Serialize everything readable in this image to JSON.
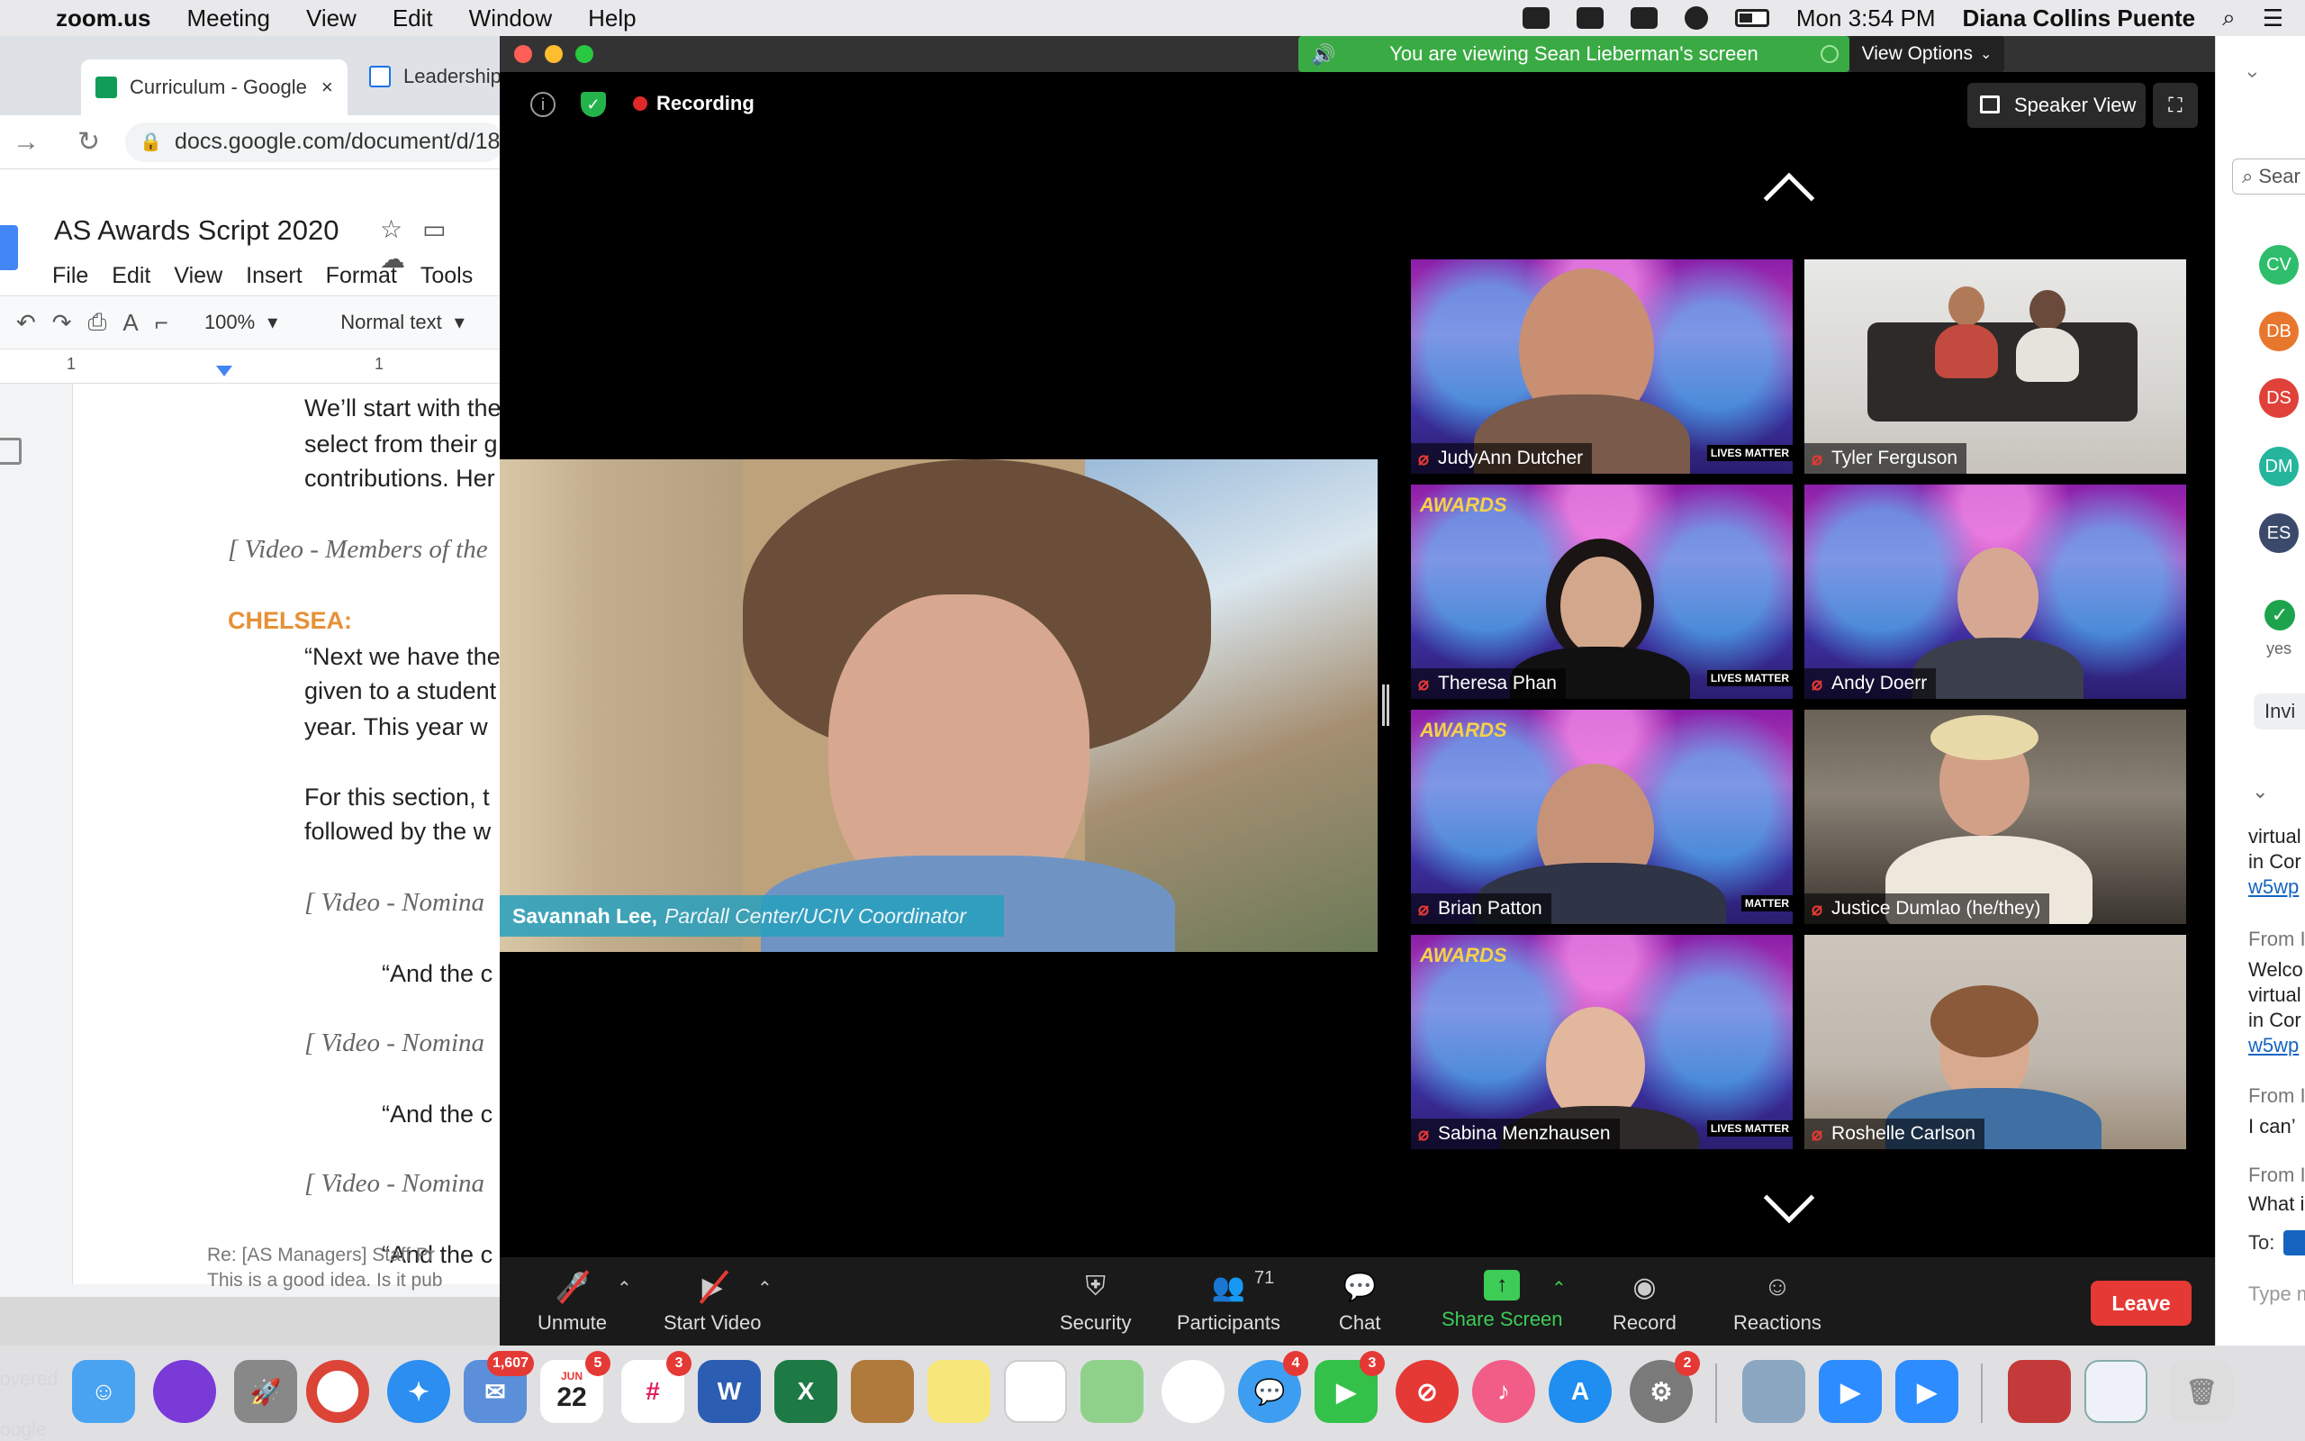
{
  "menubar": {
    "app": "zoom.us",
    "items": [
      "Meeting",
      "View",
      "Edit",
      "Window",
      "Help"
    ],
    "datetime": "Mon 3:54 PM",
    "user": "Diana Collins Puente"
  },
  "chrome": {
    "tabs": [
      {
        "label": "Curriculum - Google",
        "close": "×"
      },
      {
        "label": "Leadership"
      }
    ],
    "url": "docs.google.com/document/d/18",
    "doc_title": "AS Awards Script 2020",
    "menu": [
      "File",
      "Edit",
      "View",
      "Insert",
      "Format",
      "Tools"
    ],
    "zoom": "100%",
    "style": "Normal text",
    "ruler_marks": [
      "1",
      "1"
    ],
    "lines": [
      "We’ll start with the",
      "select from their g",
      "contributions. Her",
      "[ Video - Members of the",
      "CHELSEA:",
      "“Next we have the",
      "given to a student",
      "year. This year w",
      "For this section, t",
      "followed by the w",
      "[ Video - Nomina",
      "“And the c",
      "[ Video - Nomina",
      "“And the c",
      "[ Video - Nomina",
      "“And the c"
    ],
    "email_peek": [
      "Re: [AS Managers] Staff Pr",
      "This is a good idea. Is it pub"
    ],
    "left_peek": [
      "overed",
      "oogle"
    ]
  },
  "zoom": {
    "banner": "You are viewing Sean Lieberman's screen",
    "view_options": "View Options",
    "recording": "Recording",
    "speaker_view": "Speaker View",
    "speaker": {
      "name": "Savannah Lee,",
      "role": "Pardall Center/UCIV Coordinator"
    },
    "tiles": [
      {
        "name": "JudyAnn Dutcher",
        "badge": "LIVES MATTER"
      },
      {
        "name": "Tyler Ferguson"
      },
      {
        "name": "Theresa Phan",
        "badge": "LIVES MATTER",
        "awards": "AWARDS"
      },
      {
        "name": "Andy Doerr"
      },
      {
        "name": "Brian Patton",
        "badge": "MATTER",
        "awards": "AWARDS"
      },
      {
        "name": "Justice Dumlao (he/they)"
      },
      {
        "name": "Sabina Menzhausen",
        "badge": "LIVES MATTER",
        "awards": "AWARDS"
      },
      {
        "name": "Roshelle Carlson"
      }
    ],
    "controls": {
      "unmute": "Unmute",
      "start_video": "Start Video",
      "security": "Security",
      "participants": "Participants",
      "participants_count": "71",
      "chat": "Chat",
      "share_screen": "Share Screen",
      "record": "Record",
      "reactions": "Reactions",
      "leave": "Leave"
    }
  },
  "side": {
    "search": "Sear",
    "avatars": [
      {
        "initials": "CV",
        "color": "#2ebd6b"
      },
      {
        "initials": "DB",
        "color": "#e8772e"
      },
      {
        "initials": "DS",
        "color": "#e0413a"
      },
      {
        "initials": "DM",
        "color": "#25b59d"
      },
      {
        "initials": "ES",
        "color": "#3b4a6b"
      }
    ],
    "yes": "yes",
    "invite": "Invi",
    "chat": [
      "virtual",
      "in Cor",
      "w5wp",
      "From I",
      "Welco",
      "virtual",
      "in Cor",
      "w5wp",
      "From I",
      "I can’",
      "From I",
      "What i"
    ],
    "to": "To:",
    "type_placeholder": "Type m"
  },
  "dock": {
    "badges": {
      "calendar_day": "22",
      "calendar_month": "JUN",
      "calendar": "5",
      "mail": "1,607",
      "slack": "3",
      "messages": "4",
      "facetime": "3",
      "settings": "2"
    }
  }
}
